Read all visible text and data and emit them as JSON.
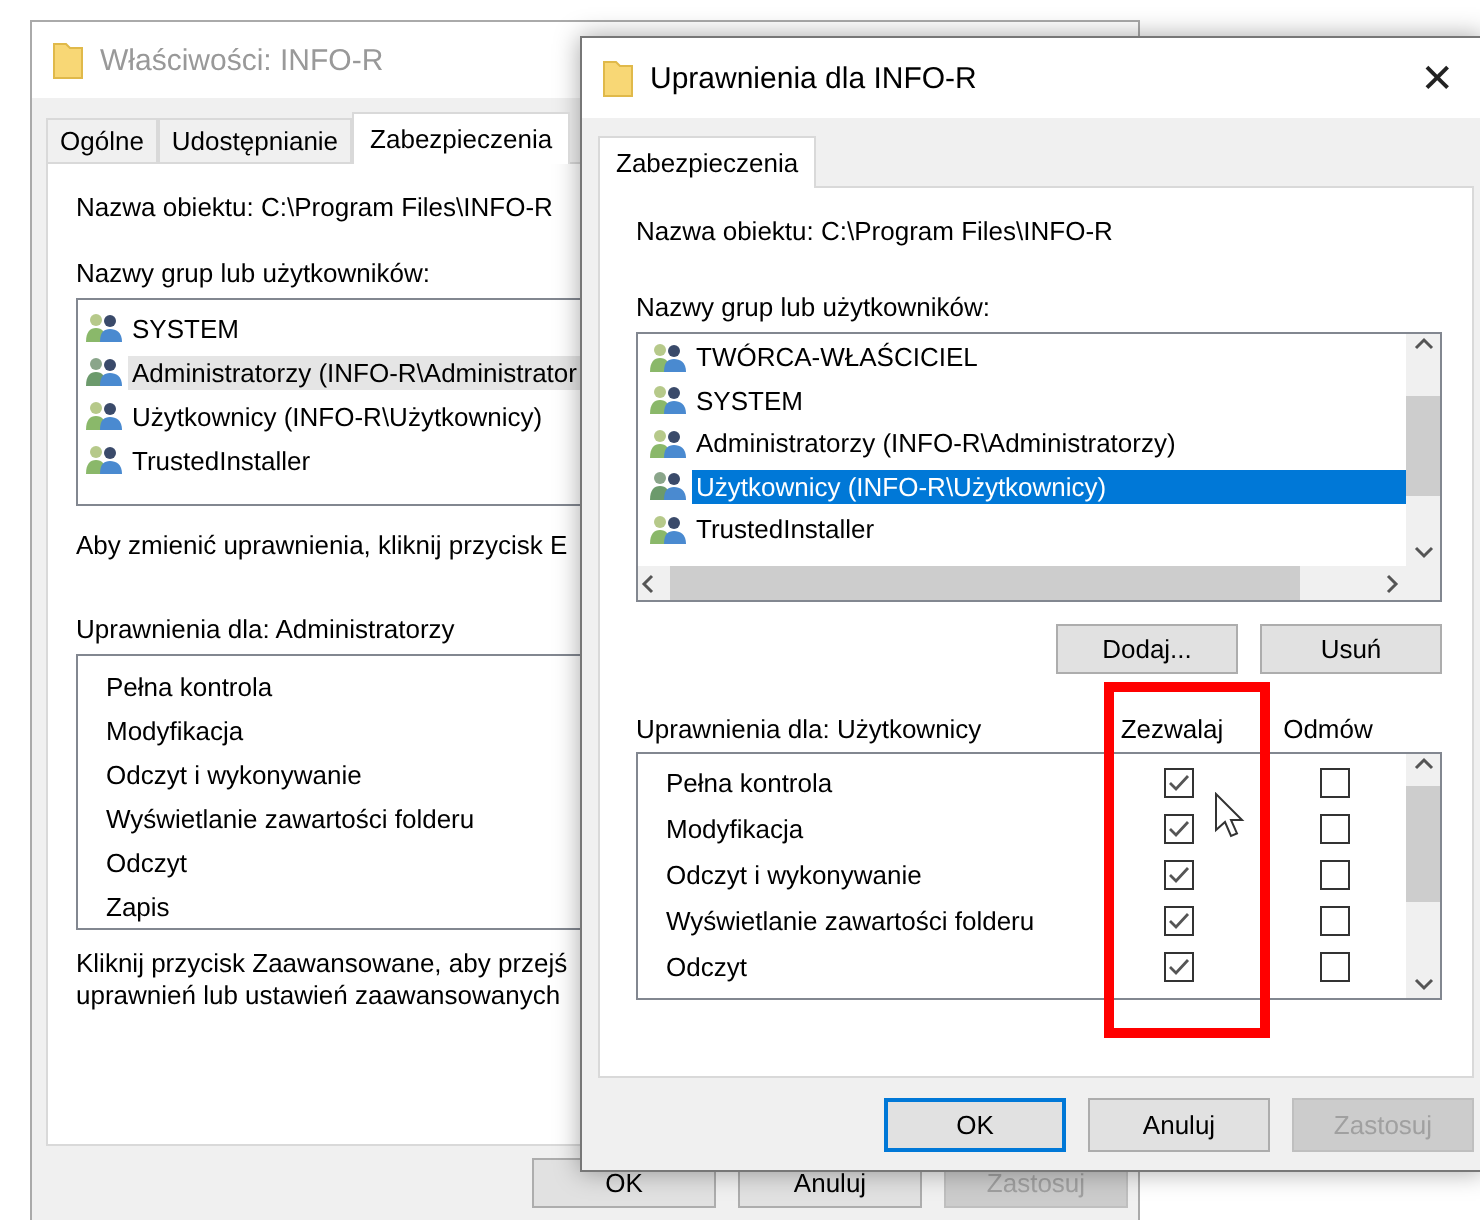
{
  "back_window": {
    "title": "Właściwości: INFO-R",
    "tabs": [
      {
        "label": "Ogólne",
        "selected": false
      },
      {
        "label": "Udostępnianie",
        "selected": false
      },
      {
        "label": "Zabezpieczenia",
        "selected": true
      }
    ],
    "object_name": {
      "label": "Nazwa obiektu:",
      "value": "C:\\Program Files\\INFO-R"
    },
    "groups_label": "Nazwy grup lub użytkowników:",
    "groups": [
      {
        "name": "SYSTEM",
        "selected": false
      },
      {
        "name": "Administratorzy (INFO-R\\Administrator",
        "selected": true
      },
      {
        "name": "Użytkownicy (INFO-R\\Użytkownicy)",
        "selected": false
      },
      {
        "name": "TrustedInstaller",
        "selected": false
      }
    ],
    "edit_hint": "Aby zmienić uprawnienia, kliknij przycisk E",
    "permissions_label": "Uprawnienia dla: Administratorzy",
    "permissions": [
      "Pełna kontrola",
      "Modyfikacja",
      "Odczyt i wykonywanie",
      "Wyświetlanie zawartości folderu",
      "Odczyt",
      "Zapis"
    ],
    "advanced_hint": [
      "Kliknij przycisk Zaawansowane, aby przejś",
      "uprawnień lub ustawień zaawansowanych"
    ],
    "buttons": [
      {
        "label": "OK",
        "disabled": false
      },
      {
        "label": "Anuluj",
        "disabled": false
      },
      {
        "label": "Zastosuj",
        "disabled": true
      }
    ]
  },
  "front_window": {
    "title": "Uprawnienia dla INFO-R",
    "close": "✕",
    "tabs": [
      {
        "label": "Zabezpieczenia",
        "selected": true
      }
    ],
    "object_name": {
      "label": "Nazwa obiektu:",
      "value": "C:\\Program Files\\INFO-R"
    },
    "groups_label": "Nazwy grup lub użytkowników:",
    "groups": [
      {
        "name": "TWÓRCA-WŁAŚCICIEL",
        "selected": false
      },
      {
        "name": "SYSTEM",
        "selected": false
      },
      {
        "name": "Administratorzy (INFO-R\\Administratorzy)",
        "selected": false
      },
      {
        "name": "Użytkownicy (INFO-R\\Użytkownicy)",
        "selected": true
      },
      {
        "name": "TrustedInstaller",
        "selected": false
      }
    ],
    "group_buttons": [
      "Dodaj...",
      "Usuń"
    ],
    "permissions_label": "Uprawnienia dla: Użytkownicy",
    "permission_columns": [
      "Zezwalaj",
      "Odmów"
    ],
    "permissions": [
      {
        "name": "Pełna kontrola",
        "allow": true,
        "deny": false
      },
      {
        "name": "Modyfikacja",
        "allow": true,
        "deny": false
      },
      {
        "name": "Odczyt i wykonywanie",
        "allow": true,
        "deny": false
      },
      {
        "name": "Wyświetlanie zawartości folderu",
        "allow": true,
        "deny": false
      },
      {
        "name": "Odczyt",
        "allow": true,
        "deny": false
      }
    ],
    "buttons": [
      {
        "label": "OK",
        "disabled": false,
        "default": true
      },
      {
        "label": "Anuluj",
        "disabled": false,
        "default": false
      },
      {
        "label": "Zastosuj",
        "disabled": true,
        "default": false
      }
    ]
  }
}
